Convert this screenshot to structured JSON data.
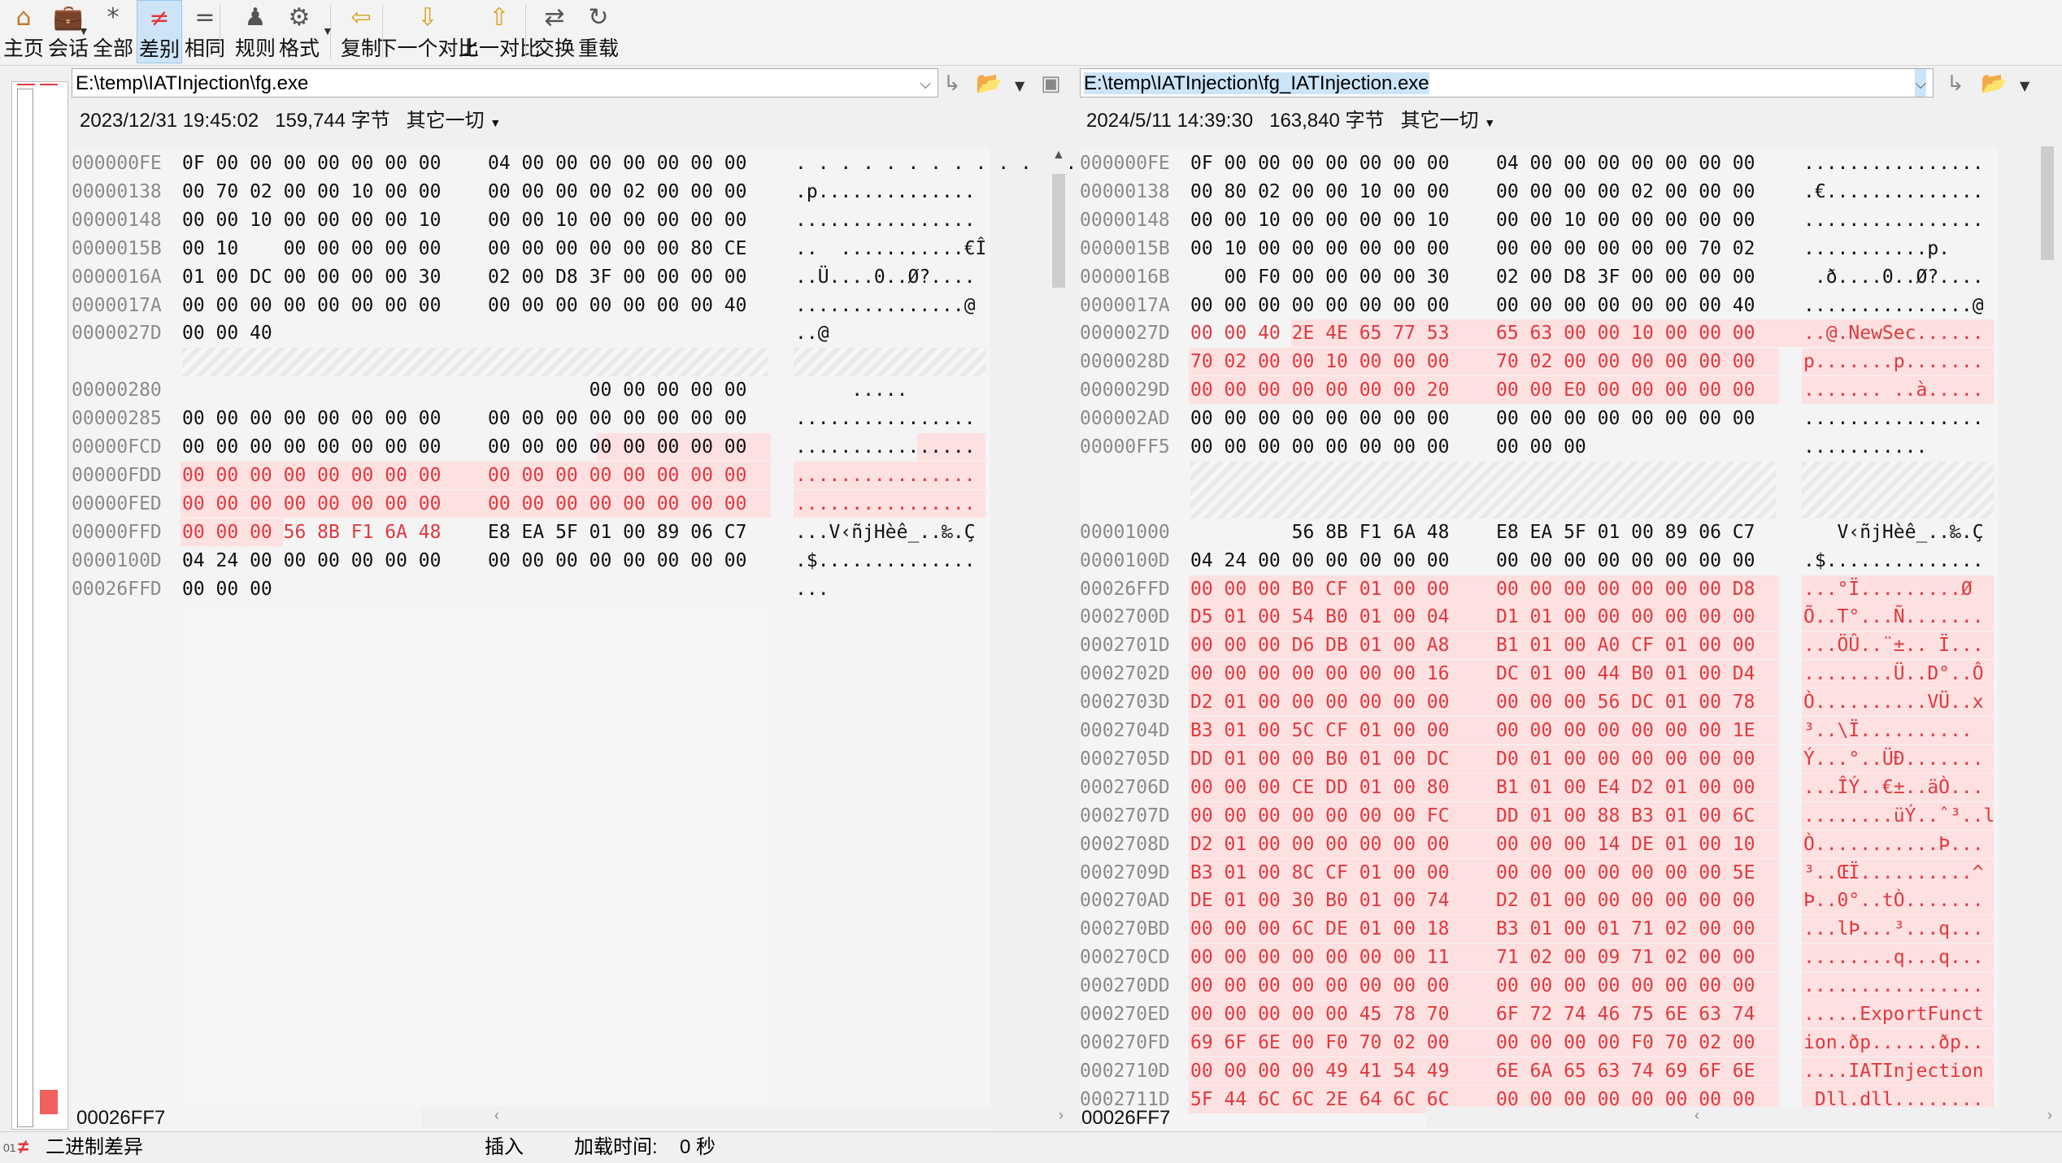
{
  "toolbar": {
    "buttons": [
      {
        "icon": "home-icon",
        "label": "主页"
      },
      {
        "icon": "briefcase-icon",
        "label": "会话"
      },
      {
        "icon": "asterisk-icon",
        "label": "全部"
      },
      {
        "icon": "not-equal-icon",
        "label": "差别"
      },
      {
        "icon": "equal-icon",
        "label": "相同"
      },
      {
        "icon": "referee-icon",
        "label": "规则"
      },
      {
        "icon": "gear-doc-icon",
        "label": "格式"
      },
      {
        "icon": "arrow-left-icon",
        "label": "复制"
      },
      {
        "icon": "arrow-down-icon",
        "label": "下一个对比"
      },
      {
        "icon": "arrow-up-icon",
        "label": "上一对比"
      },
      {
        "icon": "swap-icon",
        "label": "交换"
      },
      {
        "icon": "reload-icon",
        "label": "重载"
      }
    ]
  },
  "left": {
    "path": "E:\\temp\\IATInjection\\fg.exe",
    "date": "2023/12/31 19:45:02",
    "size": "159,744 字节",
    "encoding": "其它一切",
    "cursor_addr": "00026FF7",
    "rows": [
      {
        "off": "000000FE",
        "b1": "0F 00 00 00 00 00 00 00",
        "b2": "04 00 00 00 00 00 00 00",
        "asc": ". . . . . . . . . . . . . . . .",
        "type": "normal"
      },
      {
        "off": "00000138",
        "b1": "00 70 02 00 00 10 00 00",
        "b2": "00 00 00 00 02 00 00 00",
        "asc": ".p..............",
        "type": "normal"
      },
      {
        "off": "00000148",
        "b1": "00 00 10 00 00 00 00 10",
        "b2": "00 00 10 00 00 00 00 00",
        "asc": "................",
        "type": "normal"
      },
      {
        "off": "0000015B",
        "b1": "00 10    00 00 00 00 00",
        "b2": "00 00 00 00 00 00 80 CE",
        "asc": "..  ...........€Î",
        "type": "normal"
      },
      {
        "off": "0000016A",
        "b1": "01 00 DC 00 00 00 00 30",
        "b2": "02 00 D8 3F 00 00 00 00",
        "asc": "..Ü....0..Ø?....",
        "type": "normal"
      },
      {
        "off": "0000017A",
        "b1": "00 00 00 00 00 00 00 00",
        "b2": "00 00 00 00 00 00 00 40",
        "asc": "...............@",
        "type": "normal"
      },
      {
        "off": "0000027D",
        "b1": "00 00 40",
        "b2": "",
        "asc": "..@",
        "type": "normal"
      },
      {
        "off": "",
        "b1": "",
        "b2": "",
        "asc": "",
        "type": "blank"
      },
      {
        "off": "00000280",
        "b1": "",
        "b2": "         00 00 00 00 00",
        "asc": "     .....",
        "type": "normal"
      },
      {
        "off": "00000285",
        "b1": "00 00 00 00 00 00 00 00",
        "b2": "00 00 00 00 00 00 00 00",
        "asc": "................",
        "type": "normal"
      },
      {
        "off": "00000FCD",
        "b1": "00 00 00 00 00 00 00 00",
        "b2": "00 00 00 00 00 00 00 00",
        "asc": "................",
        "type": "partial"
      },
      {
        "off": "00000FDD",
        "b1": "00 00 00 00 00 00 00 00",
        "b2": "00 00 00 00 00 00 00 00",
        "asc": "................",
        "type": "diff"
      },
      {
        "off": "00000FED",
        "b1": "00 00 00 00 00 00 00 00",
        "b2": "00 00 00 00 00 00 00 00",
        "asc": "................",
        "type": "diff"
      },
      {
        "off": "00000FFD",
        "b1": "00 00 00 56 8B F1 6A 48",
        "b2": "E8 EA 5F 01 00 89 06 C7",
        "asc": "...V‹ñjHèê_..‰.Ç",
        "type": "start"
      },
      {
        "off": "0000100D",
        "b1": "04 24 00 00 00 00 00 00",
        "b2": "00 00 00 00 00 00 00 00",
        "asc": ".$..............",
        "type": "normal"
      },
      {
        "off": "00026FFD",
        "b1": "00 00 00",
        "b2": "",
        "asc": "...",
        "type": "normal"
      }
    ]
  },
  "right": {
    "path": "E:\\temp\\IATInjection\\fg_IATInjection.exe",
    "date": "2024/5/11 14:39:30",
    "size": "163,840 字节",
    "encoding": "其它一切",
    "cursor_addr": "00026FF7",
    "rows": [
      {
        "off": "000000FE",
        "b1": "0F 00 00 00 00 00 00 00",
        "b2": "04 00 00 00 00 00 00 00",
        "asc": "................",
        "type": "normal"
      },
      {
        "off": "00000138",
        "b1": "00 80 02 00 00 10 00 00",
        "b2": "00 00 00 00 02 00 00 00",
        "asc": ".€..............",
        "type": "normal"
      },
      {
        "off": "00000148",
        "b1": "00 00 10 00 00 00 00 10",
        "b2": "00 00 10 00 00 00 00 00",
        "asc": "................",
        "type": "normal"
      },
      {
        "off": "0000015B",
        "b1": "00 10 00 00 00 00 00 00",
        "b2": "00 00 00 00 00 00 70 02",
        "asc": "...........p.",
        "type": "normal"
      },
      {
        "off": "0000016B",
        "b1": "   00 F0 00 00 00 00 30",
        "b2": "02 00 D8 3F 00 00 00 00",
        "asc": " .ð....0..Ø?....",
        "type": "normal"
      },
      {
        "off": "0000017A",
        "b1": "00 00 00 00 00 00 00 00",
        "b2": "00 00 00 00 00 00 00 40",
        "asc": "...............@",
        "type": "normal"
      },
      {
        "off": "0000027D",
        "b1": "00 00 40 2E 4E 65 77 53",
        "b2": "65 63 00 00 10 00 00 00",
        "asc": "..@.NewSec......",
        "type": "diff"
      },
      {
        "off": "0000028D",
        "b1": "70 02 00 00 10 00 00 00",
        "b2": "70 02 00 00 00 00 00 00",
        "asc": "p.......p.......",
        "type": "diff"
      },
      {
        "off": "0000029D",
        "b1": "00 00 00 00 00 00 00 20",
        "b2": "00 00 E0 00 00 00 00 00",
        "asc": "....... ..à.....",
        "type": "diff"
      },
      {
        "off": "000002AD",
        "b1": "00 00 00 00 00 00 00 00",
        "b2": "00 00 00 00 00 00 00 00",
        "asc": "................",
        "type": "normal"
      },
      {
        "off": "00000FF5",
        "b1": "00 00 00 00 00 00 00 00",
        "b2": "00 00 00",
        "asc": "...........",
        "type": "normal"
      },
      {
        "off": "",
        "b1": "",
        "b2": "",
        "asc": "",
        "type": "blank"
      },
      {
        "off": "00001000",
        "b1": "         56 8B F1 6A 48",
        "b2": "E8 EA 5F 01 00 89 06 C7",
        "asc": "   V‹ñjHèê_..‰.Ç",
        "type": "normal"
      },
      {
        "off": "0000100D",
        "b1": "04 24 00 00 00 00 00 00",
        "b2": "00 00 00 00 00 00 00 00",
        "asc": ".$..............",
        "type": "normal"
      },
      {
        "off": "00026FFD",
        "b1": "00 00 00 B0 CF 01 00 00",
        "b2": "00 00 00 00 00 00 00 D8",
        "asc": "...°Ï.........Ø",
        "type": "diff"
      },
      {
        "off": "0002700D",
        "b1": "D5 01 00 54 B0 01 00 04",
        "b2": "D1 01 00 00 00 00 00 00",
        "asc": "Õ..T°...Ñ.......",
        "type": "diff"
      },
      {
        "off": "0002701D",
        "b1": "00 00 00 D6 DB 01 00 A8",
        "b2": "B1 01 00 A0 CF 01 00 00",
        "asc": "...ÖÛ..¨±.. Ï...",
        "type": "diff"
      },
      {
        "off": "0002702D",
        "b1": "00 00 00 00 00 00 00 16",
        "b2": "DC 01 00 44 B0 01 00 D4",
        "asc": "........Ü..D°..Ô",
        "type": "diff"
      },
      {
        "off": "0002703D",
        "b1": "D2 01 00 00 00 00 00 00",
        "b2": "00 00 00 56 DC 01 00 78",
        "asc": "Ò..........VÜ..x",
        "type": "diff"
      },
      {
        "off": "0002704D",
        "b1": "B3 01 00 5C CF 01 00 00",
        "b2": "00 00 00 00 00 00 00 1E",
        "asc": "³..\\Ï..........",
        "type": "diff"
      },
      {
        "off": "0002705D",
        "b1": "DD 01 00 00 B0 01 00 DC",
        "b2": "D0 01 00 00 00 00 00 00",
        "asc": "Ý...°..ÜÐ.......",
        "type": "diff"
      },
      {
        "off": "0002706D",
        "b1": "00 00 00 CE DD 01 00 80",
        "b2": "B1 01 00 E4 D2 01 00 00",
        "asc": "...ÎÝ..€±..äÒ...",
        "type": "diff"
      },
      {
        "off": "0002707D",
        "b1": "00 00 00 00 00 00 00 FC",
        "b2": "DD 01 00 88 B3 01 00 6C",
        "asc": "........üÝ..ˆ³..l",
        "type": "diff"
      },
      {
        "off": "0002708D",
        "b1": "D2 01 00 00 00 00 00 00",
        "b2": "00 00 00 14 DE 01 00 10",
        "asc": "Ò...........Þ...",
        "type": "diff"
      },
      {
        "off": "0002709D",
        "b1": "B3 01 00 8C CF 01 00 00",
        "b2": "00 00 00 00 00 00 00 5E",
        "asc": "³..ŒÏ..........^",
        "type": "diff"
      },
      {
        "off": "000270AD",
        "b1": "DE 01 00 30 B0 01 00 74",
        "b2": "D2 01 00 00 00 00 00 00",
        "asc": "Þ..0°..tÒ.......",
        "type": "diff"
      },
      {
        "off": "000270BD",
        "b1": "00 00 00 6C DE 01 00 18",
        "b2": "B3 01 00 01 71 02 00 00",
        "asc": "...lÞ...³...q...",
        "type": "diff"
      },
      {
        "off": "000270CD",
        "b1": "00 00 00 00 00 00 00 11",
        "b2": "71 02 00 09 71 02 00 00",
        "asc": "........q...q...",
        "type": "diff"
      },
      {
        "off": "000270DD",
        "b1": "00 00 00 00 00 00 00 00",
        "b2": "00 00 00 00 00 00 00 00",
        "asc": "................",
        "type": "diff"
      },
      {
        "off": "000270ED",
        "b1": "00 00 00 00 00 45 78 70",
        "b2": "6F 72 74 46 75 6E 63 74",
        "asc": ".....ExportFunct",
        "type": "diff"
      },
      {
        "off": "000270FD",
        "b1": "69 6F 6E 00 F0 70 02 00",
        "b2": "00 00 00 00 F0 70 02 00",
        "asc": "ion.ðp......ðp..",
        "type": "diff"
      },
      {
        "off": "0002710D",
        "b1": "00 00 00 00 49 41 54 49",
        "b2": "6E 6A 65 63 74 69 6F 6E",
        "asc": "....IATInjection",
        "type": "diff"
      },
      {
        "off": "0002711D",
        "b1": "5F 44 6C 6C 2E 64 6C 6C",
        "b2": "00 00 00 00 00 00 00 00",
        "asc": "_Dll.dll........",
        "type": "diff"
      }
    ]
  },
  "status": {
    "label": "二进制差异",
    "mode": "插入",
    "load_time_label": "加载时间:",
    "load_time_value": "0 秒"
  },
  "colors": {
    "diff_bg": "#fde0e0",
    "diff_text": "#e0393e",
    "cursor": "#00e5ee"
  }
}
